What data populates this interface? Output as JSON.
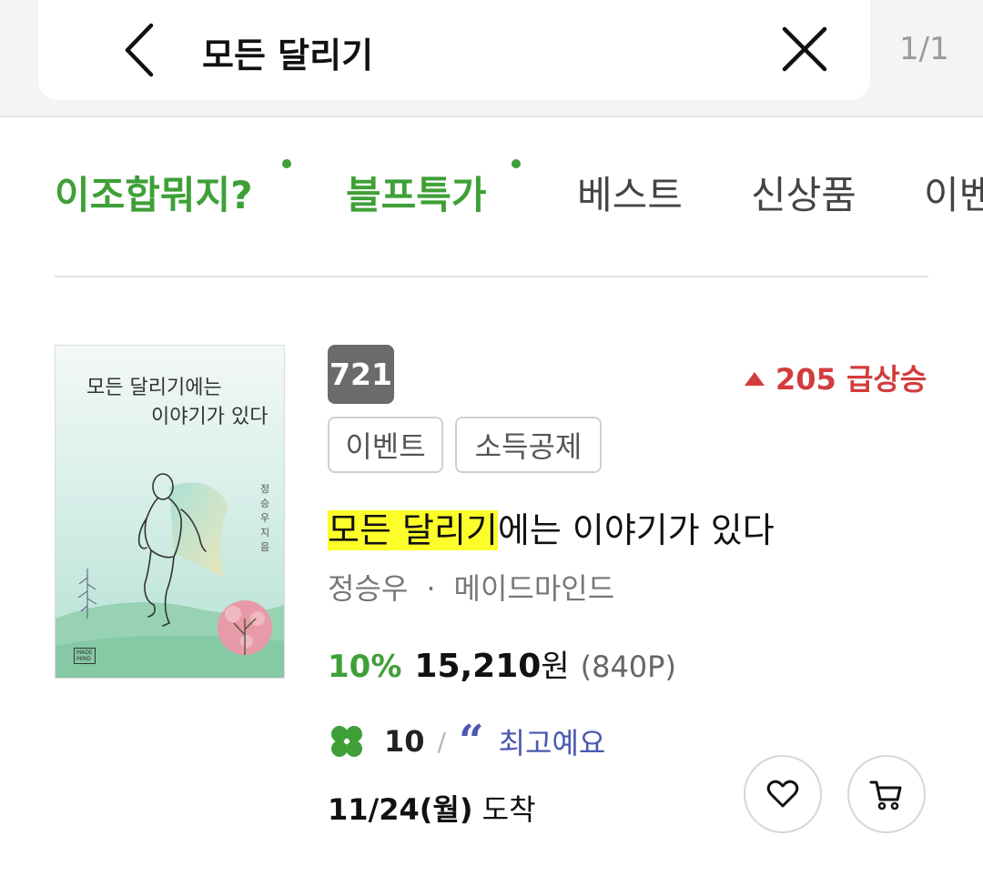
{
  "search": {
    "query": "모든 달리기",
    "page_indicator": "1/1",
    "back_icon": "chevron-left-icon",
    "clear_icon": "close-icon"
  },
  "tabs": [
    {
      "label": "이조합뭐지?",
      "has_dot": true,
      "color": "#3ea037"
    },
    {
      "label": "블프특가",
      "has_dot": true,
      "color": "#3ea037"
    },
    {
      "label": "베스트",
      "has_dot": false
    },
    {
      "label": "신상품",
      "has_dot": false
    },
    {
      "label": "이벤",
      "has_dot": false
    }
  ],
  "product": {
    "cover": {
      "title_line1": "모든 달리기에는",
      "title_line2": "이야기가 있다",
      "author_vertical": "정승우 지음",
      "publisher_logo": "MADE MIND"
    },
    "rank": "721",
    "rank_change": "205 급상승",
    "tags": [
      "이벤트",
      "소득공제"
    ],
    "title_highlight": "모든 달리기",
    "title_rest": "에는 이야기가 있다",
    "author": "정승우",
    "separator": "·",
    "publisher": "메이드마인드",
    "discount": "10%",
    "price": "15,210",
    "currency": "원",
    "points": "(840P)",
    "review_count": "10",
    "review_slash": "/",
    "review_quote": "“",
    "review_text": "최고예요",
    "delivery_date": "11/24(월)",
    "delivery_label": "도착",
    "colors": {
      "accent_green": "#3ea037",
      "rank_up_red": "#d33c3c",
      "review_blue": "#4a58b0",
      "highlight": "#fdfd2a"
    }
  }
}
